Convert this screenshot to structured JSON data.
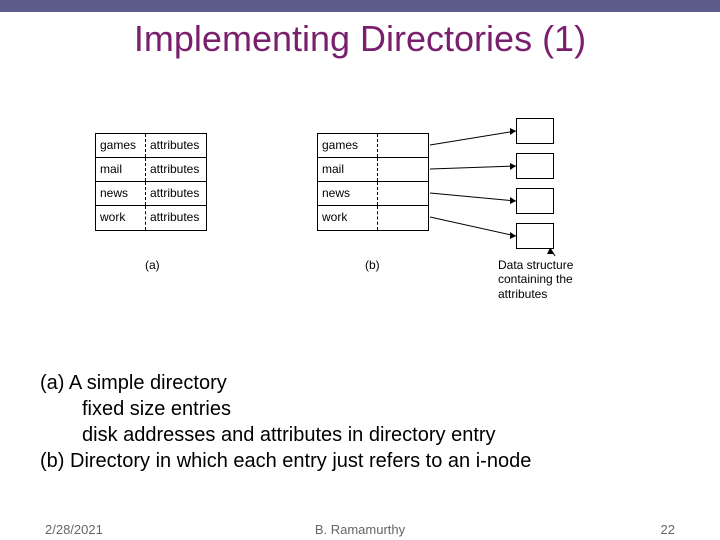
{
  "title": "Implementing Directories (1)",
  "table_a": {
    "rows": [
      {
        "name": "games",
        "attr": "attributes"
      },
      {
        "name": "mail",
        "attr": "attributes"
      },
      {
        "name": "news",
        "attr": "attributes"
      },
      {
        "name": "work",
        "attr": "attributes"
      }
    ],
    "label": "(a)"
  },
  "table_b": {
    "rows": [
      {
        "name": "games"
      },
      {
        "name": "mail"
      },
      {
        "name": "news"
      },
      {
        "name": "work"
      }
    ],
    "label": "(b)"
  },
  "ds_caption": "Data structure containing the attributes",
  "body": {
    "line1": "(a) A simple directory",
    "line2": "fixed size entries",
    "line3": "disk addresses and attributes in directory entry",
    "line4": "(b) Directory in which each entry just refers to an i-node"
  },
  "footer": {
    "date": "2/28/2021",
    "author": "B. Ramamurthy",
    "page": "22"
  }
}
